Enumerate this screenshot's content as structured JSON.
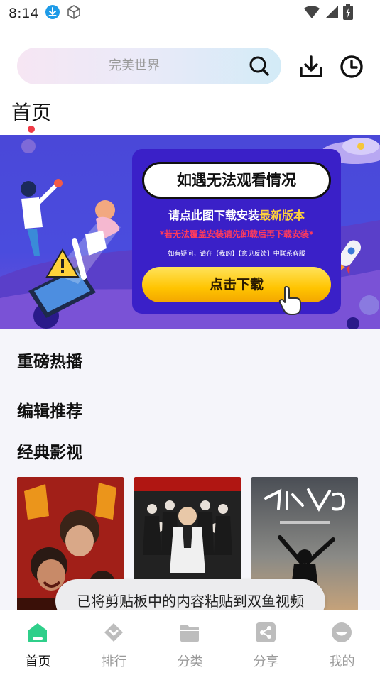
{
  "status_bar": {
    "time": "8:14"
  },
  "search": {
    "placeholder": "完美世界"
  },
  "tabs": {
    "home": "首页"
  },
  "banner": {
    "title": "如遇无法观看情况",
    "line1_prefix": "请点此图下载安装",
    "line1_highlight": "最新版本",
    "line2": "*若无法覆盖安装请先卸载后再下载安装*",
    "line3": "如有疑问，请在【我的】【意见反馈】中联系客服",
    "button": "点击下载"
  },
  "sections": {
    "hot": "重磅热播",
    "editor": "编辑推荐",
    "classic": "经典影视"
  },
  "toast": "已将剪贴板中的内容粘贴到双鱼视频",
  "bottom_nav": [
    {
      "label": "首页",
      "icon": "home-icon",
      "active": true
    },
    {
      "label": "排行",
      "icon": "ranking-icon",
      "active": false
    },
    {
      "label": "分类",
      "icon": "category-icon",
      "active": false
    },
    {
      "label": "分享",
      "icon": "share-icon",
      "active": false
    },
    {
      "label": "我的",
      "icon": "profile-icon",
      "active": false
    }
  ],
  "colors": {
    "accent_green": "#2fcf8a",
    "indicator_red": "#ef3b46",
    "banner_blue": "#4a48d8",
    "button_yellow": "#ffc400"
  }
}
